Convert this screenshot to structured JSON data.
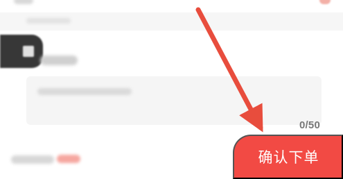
{
  "remark": {
    "char_counter": "0/50"
  },
  "submit": {
    "confirm_label": "确认下单"
  },
  "colors": {
    "accent_red": "#f24a44",
    "arrow_red": "#e84d3d",
    "counter_gray": "#777777",
    "input_bg": "#f5f5f5"
  },
  "icons": {
    "annotation_arrow": "arrow-down-right"
  }
}
